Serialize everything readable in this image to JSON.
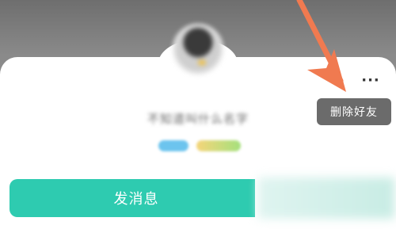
{
  "profile": {
    "nickname": "不知道叫什么名字"
  },
  "menu": {
    "more_label": "···",
    "delete_friend_label": "删除好友"
  },
  "actions": {
    "send_message_label": "发消息"
  },
  "colors": {
    "primary_button": "#2ecbb0",
    "annotation_arrow": "#f07a50",
    "popup_bg": "#6b6b6b"
  },
  "icons": {
    "more": "ellipsis-icon",
    "annotation": "arrow-annotation-icon"
  }
}
